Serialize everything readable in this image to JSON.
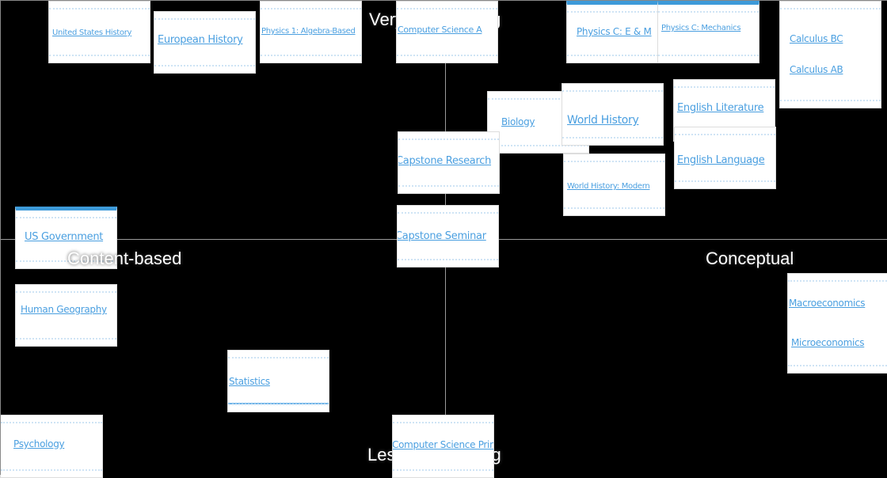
{
  "axes": {
    "top": "Very Challenging",
    "bottom": "Less Challenging",
    "left": "Content-based",
    "right": "Conceptual"
  },
  "colors": {
    "background": "#000000",
    "link": "#4a9fe0",
    "accent_bar": "#3d9ad9"
  },
  "courses": [
    "United States History",
    "European History",
    "Physics 1: Algebra-Based",
    "Computer Science A",
    "Physics C: E & M",
    "Physics C: Mechanics",
    "Calculus BC",
    "Calculus AB",
    "Biology",
    "World History",
    "English Literature",
    "English Language",
    "Capstone Research",
    "World History: Modern",
    "Capstone Seminar",
    "US Government",
    "Human Geography",
    "Statistics",
    "Psychology",
    "Computer Science Principles",
    "Macroeconomics",
    "Microeconomics"
  ]
}
